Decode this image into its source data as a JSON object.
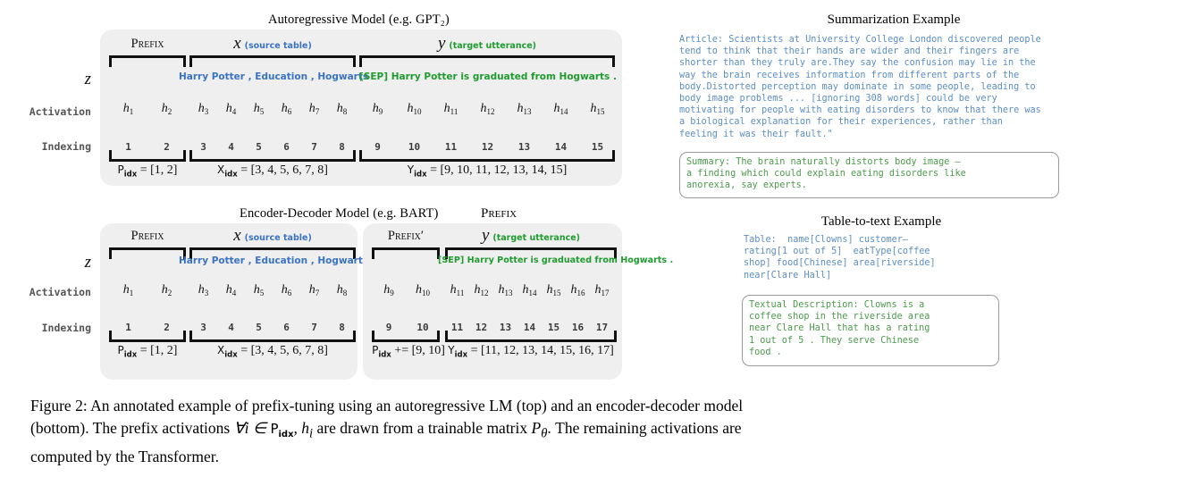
{
  "figure": {
    "caption_line1": "Figure 2:  An annotated example of prefix-tuning using an autoregressive LM (top) and an encoder-decoder model",
    "caption_line2_a": "(bottom). The prefix activations ",
    "caption_forall": "∀i ∈ ",
    "caption_pidx": "P",
    "caption_pidx_sub": "idx",
    "caption_line2_b": ", h",
    "caption_hi_sub": "i",
    "caption_line2_c": " are drawn from a trainable matrix ",
    "caption_ptheta": "P",
    "caption_ptheta_sub": "θ",
    "caption_line2_d": ". The remaining activations are",
    "caption_line3": "computed by the Transformer."
  },
  "row_labels": {
    "z": "z",
    "activation": "Activation",
    "indexing": "Indexing"
  },
  "top_panel": {
    "title": "Autoregressive Model  (e.g. GPT₂)",
    "segments": [
      {
        "header": "Prefix",
        "header_kind": "smallcaps",
        "sub": "",
        "tokens": "",
        "token_color": "",
        "h": [
          "h1",
          "h2"
        ],
        "idx": [
          "1",
          "2"
        ],
        "formula": "P",
        "formula_sub": "idx",
        "formula_rest": " = [1, 2]"
      },
      {
        "header": "x",
        "header_kind": "italic",
        "sub": "(source table)",
        "sub_color": "blue",
        "tokens": "Harry  Potter ,  Education ,  Hogwarts",
        "token_color": "blue",
        "h": [
          "h3",
          "h4",
          "h5",
          "h6",
          "h7",
          "h8"
        ],
        "idx": [
          "3",
          "4",
          "5",
          "6",
          "7",
          "8"
        ],
        "formula": "X",
        "formula_sub": "idx",
        "formula_rest": " = [3, 4, 5, 6, 7, 8]"
      },
      {
        "header": "y",
        "header_kind": "italic",
        "sub": "(target utterance)",
        "sub_color": "green",
        "tokens": "[SEP]  Harry Potter   is  graduated  from  Hogwarts .",
        "token_color": "green",
        "h": [
          "h9",
          "h10",
          "h11",
          "h12",
          "h13",
          "h14",
          "h15"
        ],
        "idx": [
          "9",
          "10",
          "11",
          "12",
          "13",
          "14",
          "15"
        ],
        "formula": "Y",
        "formula_sub": "idx",
        "formula_rest": " = [9, 10, 11, 12, 13, 14, 15]"
      }
    ]
  },
  "bottom_left_panel": {
    "title": "Encoder-Decoder Model  (e.g. BART)",
    "segments": [
      {
        "header": "Prefix",
        "header_kind": "smallcaps",
        "sub": "",
        "tokens": "",
        "token_color": "",
        "h": [
          "h1",
          "h2"
        ],
        "idx": [
          "1",
          "2"
        ],
        "formula": "P",
        "formula_sub": "idx",
        "formula_rest": " = [1, 2]"
      },
      {
        "header": "x",
        "header_kind": "italic",
        "sub": "(source table)",
        "sub_color": "blue",
        "tokens": "Harry  Potter ,  Education ,  Hogwarts",
        "token_color": "blue",
        "h": [
          "h3",
          "h4",
          "h5",
          "h6",
          "h7",
          "h8"
        ],
        "idx": [
          "3",
          "4",
          "5",
          "6",
          "7",
          "8"
        ],
        "formula": "X",
        "formula_sub": "idx",
        "formula_rest": " = [3, 4, 5, 6, 7, 8]"
      }
    ]
  },
  "bottom_right_panel": {
    "outside_title": "Prefix",
    "segments": [
      {
        "header": "Prefix′",
        "header_kind": "smallcaps",
        "sub": "",
        "tokens": "",
        "token_color": "",
        "h": [
          "h9",
          "h10"
        ],
        "idx": [
          "9",
          "10"
        ],
        "formula": "P",
        "formula_sub": "idx",
        "formula_rest": " += [9, 10]"
      },
      {
        "header": "y",
        "header_kind": "italic",
        "sub": "(target utterance)",
        "sub_color": "green",
        "tokens": "[SEP]  Harry Potter   is  graduated  from  Hogwarts .",
        "token_color": "green",
        "h": [
          "h11",
          "h12",
          "h13",
          "h14",
          "h15",
          "h16",
          "h17"
        ],
        "idx": [
          "11",
          "12",
          "13",
          "14",
          "15",
          "16",
          "17"
        ],
        "formula": "Y",
        "formula_sub": "idx",
        "formula_rest": " = [11, 12, 13, 14, 15, 16, 17]"
      }
    ]
  },
  "summarization_example": {
    "title": "Summarization Example",
    "article": "Article: Scientists at University College London discovered people\ntend to think that their hands are wider and their fingers are\nshorter than they truly are.They say the confusion may lie in the\nway the brain receives information from different parts of the\nbody.Distorted perception may dominate in some people, leading to\nbody image problems ... [ignoring 308 words] could be very\nmotivating for people with eating disorders to know that there was\na biological explanation for their experiences, rather than\nfeeling it was their fault.\"",
    "summary": "Summary: The brain naturally distorts body image —\na finding which could explain eating disorders like\nanorexia, say experts."
  },
  "table_to_text_example": {
    "title": "Table-to-text Example",
    "table": "Table:  name[Clowns] customer—\nrating[1 out of 5]  eatType[coffee\nshop] food[Chinese] area[riverside]\nnear[Clare Hall]",
    "description": "Textual Description: Clowns is a\ncoffee shop in the riverside area\nnear Clare Hall that has a rating\n1 out of 5 . They serve Chinese\nfood ."
  },
  "colors": {
    "blue": "#3b73c4",
    "green": "#1f9c2f",
    "panel_bg": "#efefef",
    "bracket": "#111111",
    "article_blue": "#5b8ec4",
    "summary_green": "#4c9a4c"
  }
}
